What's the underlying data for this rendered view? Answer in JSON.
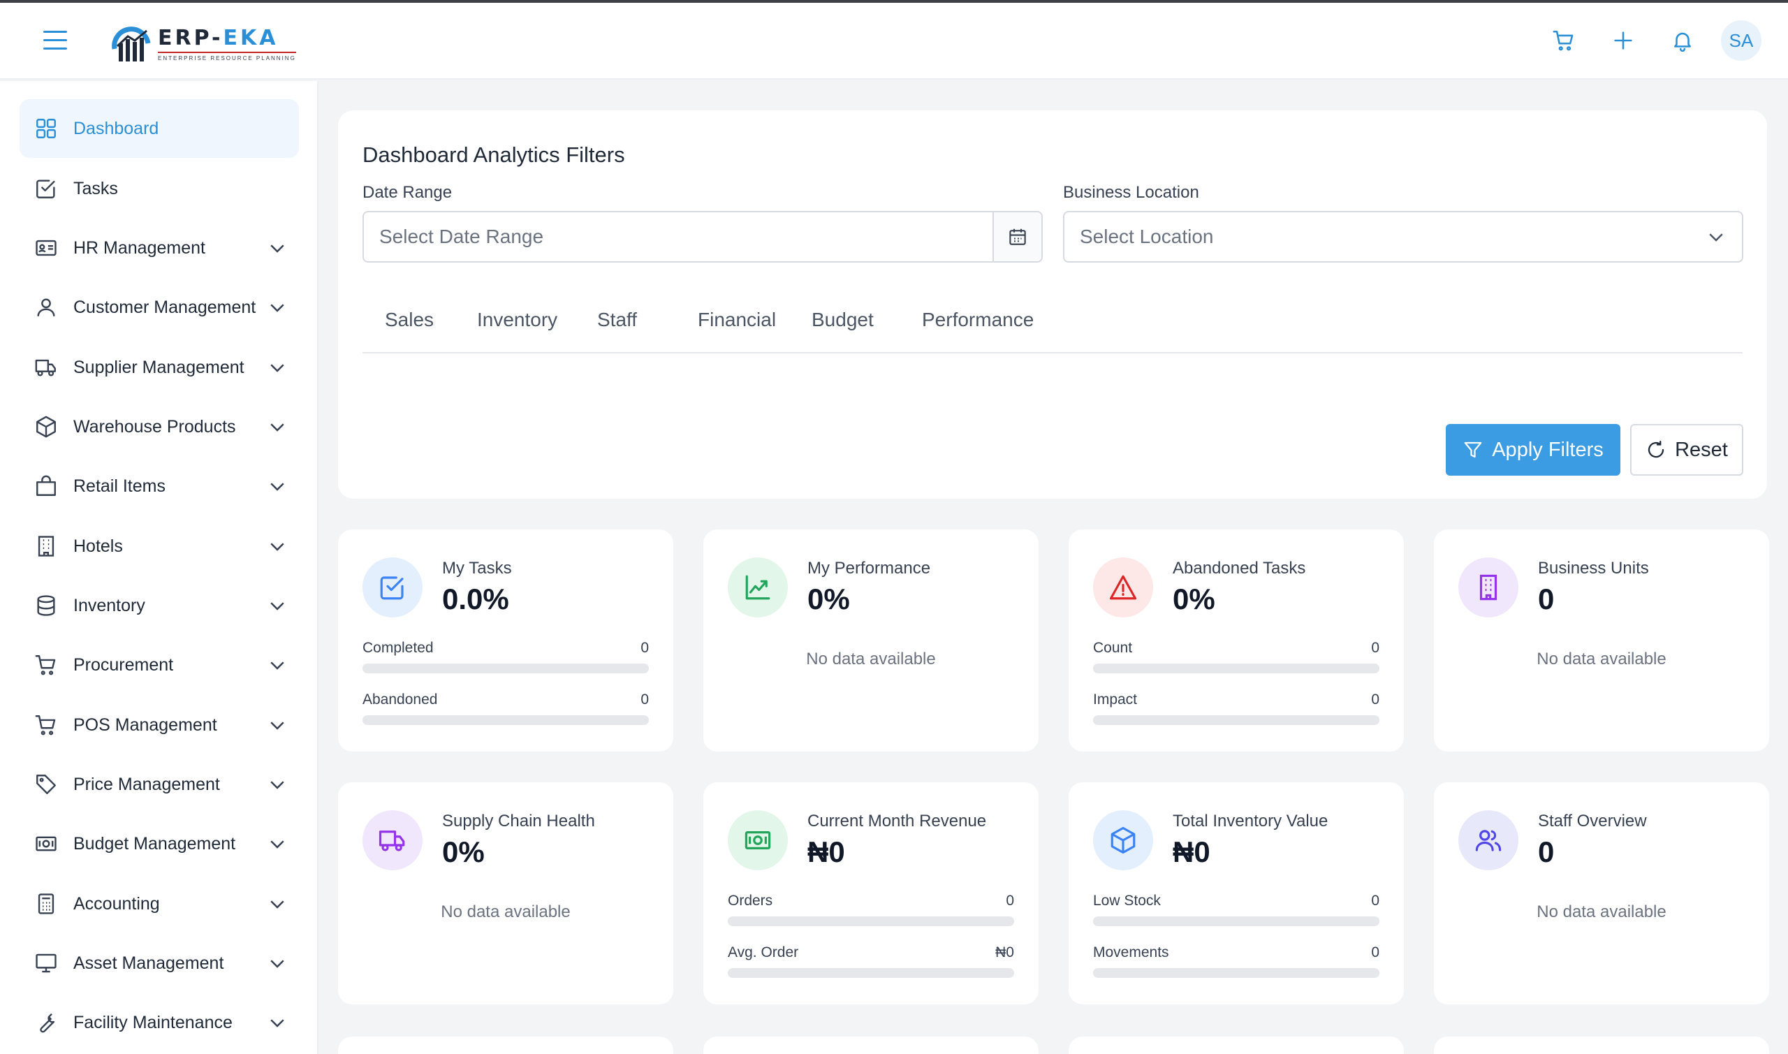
{
  "app": {
    "logo_main_prefix": "ERP-",
    "logo_main_accent": "EKA",
    "logo_sub": "ENTERPRISE RESOURCE PLANNING",
    "brand_color": "#2b8fd8"
  },
  "header": {
    "icons": [
      "cart-icon",
      "plus-icon",
      "bell-icon"
    ],
    "avatar_initials": "SA"
  },
  "sidebar": {
    "items": [
      {
        "label": "Dashboard",
        "icon": "grid-icon",
        "active": true,
        "expandable": false
      },
      {
        "label": "Tasks",
        "icon": "checkbox-icon",
        "active": false,
        "expandable": false
      },
      {
        "label": "HR Management",
        "icon": "id-card-icon",
        "active": false,
        "expandable": true
      },
      {
        "label": "Customer Management",
        "icon": "user-icon",
        "active": false,
        "expandable": true
      },
      {
        "label": "Supplier Management",
        "icon": "truck-icon",
        "active": false,
        "expandable": true
      },
      {
        "label": "Warehouse Products",
        "icon": "box-icon",
        "active": false,
        "expandable": true
      },
      {
        "label": "Retail Items",
        "icon": "shopping-bag-icon",
        "active": false,
        "expandable": true
      },
      {
        "label": "Hotels",
        "icon": "building-icon",
        "active": false,
        "expandable": true
      },
      {
        "label": "Inventory",
        "icon": "database-icon",
        "active": false,
        "expandable": true
      },
      {
        "label": "Procurement",
        "icon": "cart-icon",
        "active": false,
        "expandable": true
      },
      {
        "label": "POS Management",
        "icon": "cart-icon",
        "active": false,
        "expandable": true
      },
      {
        "label": "Price Management",
        "icon": "tag-icon",
        "active": false,
        "expandable": true
      },
      {
        "label": "Budget Management",
        "icon": "cash-icon",
        "active": false,
        "expandable": true
      },
      {
        "label": "Accounting",
        "icon": "calculator-icon",
        "active": false,
        "expandable": true
      },
      {
        "label": "Asset Management",
        "icon": "monitor-icon",
        "active": false,
        "expandable": true
      },
      {
        "label": "Facility Maintenance",
        "icon": "wrench-icon",
        "active": false,
        "expandable": true
      }
    ]
  },
  "filters": {
    "title": "Dashboard Analytics Filters",
    "date_label": "Date Range",
    "date_placeholder": "Select Date Range",
    "location_label": "Business Location",
    "location_placeholder": "Select Location",
    "tabs": [
      "Sales",
      "Inventory",
      "Staff",
      "Financial",
      "Budget",
      "Performance"
    ],
    "apply_label": "Apply Filters",
    "reset_label": "Reset"
  },
  "cards": [
    {
      "title": "My Tasks",
      "value": "0.0%",
      "icon": "checkbox-icon",
      "icon_color": "#3b82f6",
      "icon_bg": "#e3effc",
      "metrics": [
        {
          "label": "Completed",
          "value": "0",
          "fill": 0
        },
        {
          "label": "Abandoned",
          "value": "0",
          "fill": 0
        }
      ]
    },
    {
      "title": "My Performance",
      "value": "0%",
      "icon": "trend-up-icon",
      "icon_color": "#22a55a",
      "icon_bg": "#e3f6ea",
      "empty": "No data available"
    },
    {
      "title": "Abandoned Tasks",
      "value": "0%",
      "icon": "warning-icon",
      "icon_color": "#dc2626",
      "icon_bg": "#fde7e7",
      "metrics": [
        {
          "label": "Count",
          "value": "0",
          "fill": 0
        },
        {
          "label": "Impact",
          "value": "0",
          "fill": 0
        }
      ]
    },
    {
      "title": "Business Units",
      "value": "0",
      "icon": "building-icon",
      "icon_color": "#9333ea",
      "icon_bg": "#f1e7fc",
      "empty": "No data available"
    },
    {
      "title": "Supply Chain Health",
      "value": "0%",
      "icon": "truck-icon",
      "icon_color": "#9333ea",
      "icon_bg": "#f1e7fc",
      "empty": "No data available"
    },
    {
      "title": "Current Month Revenue",
      "value": "₦0",
      "icon": "cash-icon",
      "icon_color": "#22a55a",
      "icon_bg": "#e3f6ea",
      "metrics": [
        {
          "label": "Orders",
          "value": "0",
          "fill": 0
        },
        {
          "label": "Avg. Order",
          "value": "₦0",
          "fill": 0
        }
      ]
    },
    {
      "title": "Total Inventory Value",
      "value": "₦0",
      "icon": "cube-icon",
      "icon_color": "#3b82f6",
      "icon_bg": "#e3effc",
      "metrics": [
        {
          "label": "Low Stock",
          "value": "0",
          "fill": 0
        },
        {
          "label": "Movements",
          "value": "0",
          "fill": 0
        }
      ]
    },
    {
      "title": "Staff Overview",
      "value": "0",
      "icon": "users-icon",
      "icon_color": "#4f46e5",
      "icon_bg": "#e8e8fb",
      "empty": "No data available"
    }
  ]
}
